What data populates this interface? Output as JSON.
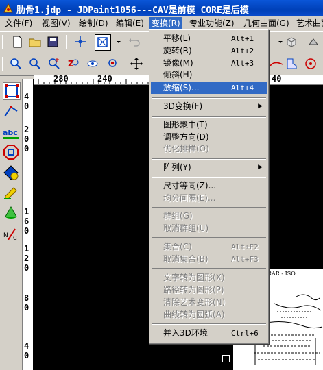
{
  "window": {
    "title": "肋骨1.jdp - JDPaint1056---CAV是前模 CORE是后模"
  },
  "menubar": [
    {
      "label": "文件(F)"
    },
    {
      "label": "视图(V)"
    },
    {
      "label": "绘制(D)"
    },
    {
      "label": "编辑(E)"
    },
    {
      "label": "变换(R)"
    },
    {
      "label": "专业功能(Z)"
    },
    {
      "label": "几何曲面(G)"
    },
    {
      "label": "艺术曲面"
    }
  ],
  "dropdown": {
    "items": [
      {
        "label": "平移(L)",
        "shortcut": "Alt+1",
        "state": "normal"
      },
      {
        "label": "旋转(R)",
        "shortcut": "Alt+2",
        "state": "normal"
      },
      {
        "label": "镜像(M)",
        "shortcut": "Alt+3",
        "state": "normal"
      },
      {
        "label": "倾斜(H)",
        "shortcut": "",
        "state": "normal"
      },
      {
        "label": "放缩(S)...",
        "shortcut": "Alt+4",
        "state": "highlighted"
      },
      {
        "label": "3D变换(F)",
        "shortcut": "",
        "state": "submenu"
      },
      {
        "label": "图形聚中(T)",
        "shortcut": "",
        "state": "normal"
      },
      {
        "label": "调整方向(D)",
        "shortcut": "",
        "state": "normal"
      },
      {
        "label": "优化排样(O)",
        "shortcut": "",
        "state": "disabled"
      },
      {
        "label": "阵列(Y)",
        "shortcut": "",
        "state": "submenu"
      },
      {
        "label": "尺寸等同(Z)...",
        "shortcut": "",
        "state": "normal"
      },
      {
        "label": "均分间隔(E)...",
        "shortcut": "",
        "state": "disabled"
      },
      {
        "label": "群组(G)",
        "shortcut": "",
        "state": "disabled"
      },
      {
        "label": "取消群组(U)",
        "shortcut": "",
        "state": "disabled"
      },
      {
        "label": "集合(C)",
        "shortcut": "Alt+F2",
        "state": "disabled"
      },
      {
        "label": "取消集合(B)",
        "shortcut": "Alt+F3",
        "state": "disabled"
      },
      {
        "label": "文字转为图形(X)",
        "shortcut": "",
        "state": "disabled"
      },
      {
        "label": "路径转为图形(P)",
        "shortcut": "",
        "state": "disabled"
      },
      {
        "label": "清除艺术变形(N)",
        "shortcut": "",
        "state": "disabled"
      },
      {
        "label": "曲线转为圆弧(A)",
        "shortcut": "",
        "state": "disabled"
      },
      {
        "label": "并入3D环境",
        "shortcut": "Ctrl+6",
        "state": "normal"
      }
    ]
  },
  "ruler": {
    "h_labels": [
      "280",
      "240",
      "40"
    ],
    "v_labels": [
      "4",
      "0",
      "2",
      "0",
      "0",
      "1",
      "6",
      "0",
      "1",
      "2",
      "0",
      "8",
      "0",
      "4",
      "0"
    ]
  },
  "canvas": {
    "background": "#000000",
    "drawing_text": "LL IN GYORAR - ISO"
  },
  "colors": {
    "titlebar": "#0a4ccc",
    "menu_highlight": "#316ac5",
    "face": "#d4d0c8"
  }
}
